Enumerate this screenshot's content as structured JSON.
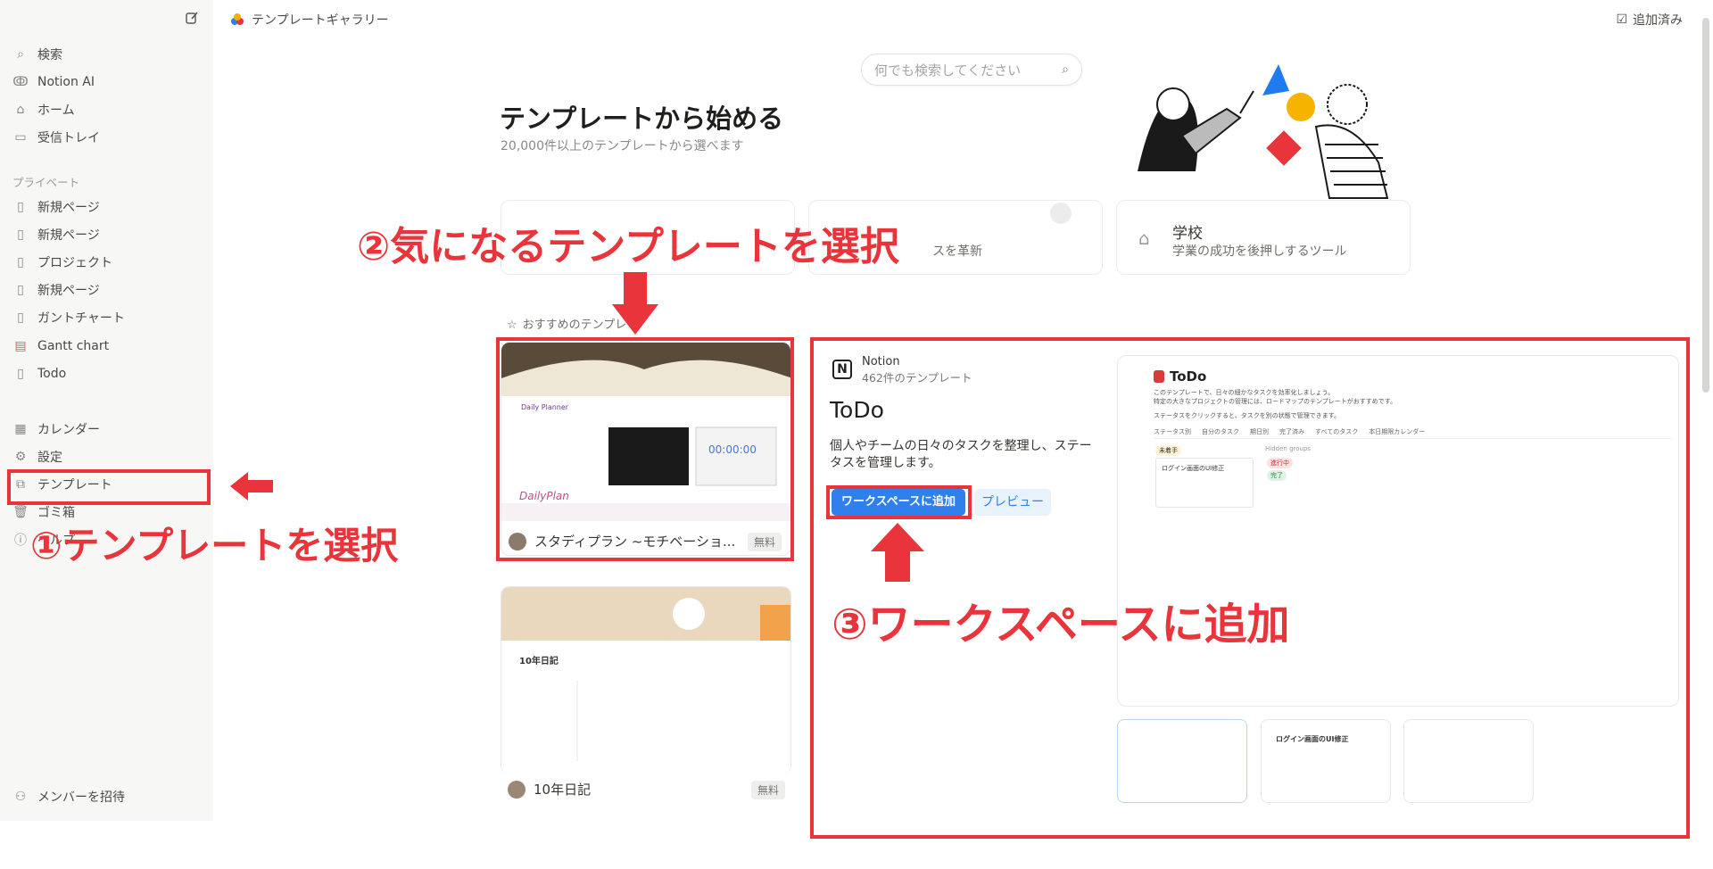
{
  "sidebar": {
    "items": [
      {
        "icon": "search-icon",
        "label": "検索"
      },
      {
        "icon": "notion-ai-icon",
        "label": "Notion AI"
      },
      {
        "icon": "home-icon",
        "label": "ホーム"
      },
      {
        "icon": "inbox-icon",
        "label": "受信トレイ"
      }
    ],
    "private_label": "プライベート",
    "pages": [
      {
        "icon": "page-icon",
        "label": "新規ページ"
      },
      {
        "icon": "page-icon",
        "label": "新規ページ"
      },
      {
        "icon": "page-icon",
        "label": "プロジェクト"
      },
      {
        "icon": "page-icon",
        "label": "新規ページ"
      },
      {
        "icon": "page-icon",
        "label": "ガントチャート"
      },
      {
        "icon": "calendar-page-icon",
        "label": "Gantt chart"
      },
      {
        "icon": "page-icon",
        "label": "Todo"
      }
    ],
    "bottom": [
      {
        "icon": "calendar-icon",
        "label": "カレンダー"
      },
      {
        "icon": "gear-icon",
        "label": "設定"
      },
      {
        "icon": "template-icon",
        "label": "テンプレート"
      },
      {
        "icon": "trash-icon",
        "label": "ゴミ箱"
      },
      {
        "icon": "help-icon",
        "label": "ヘルプ"
      }
    ],
    "invite": "メンバーを招待"
  },
  "header": {
    "breadcrumb": "テンプレートギャラリー",
    "added": "追加済み"
  },
  "search": {
    "placeholder": "何でも検索してください"
  },
  "hero": {
    "title": "テンプレートから始める",
    "subtitle": "20,000件以上のテンプレートから選べます"
  },
  "categories": [
    {
      "title": "",
      "desc": "スを革新"
    },
    {
      "title": "学校",
      "desc": "学業の成功を後押しするツール"
    }
  ],
  "recommended_label": "おすすめのテンプレ",
  "template_cards": [
    {
      "name": "スタディプラン ~モチベーショ...",
      "badge": "無料"
    },
    {
      "name": "10年日記",
      "badge": "無料"
    }
  ],
  "card_thumb_texts": {
    "daily_planner": "Daily Planner",
    "daily_plan": "DailyPlan",
    "timer": "00:00:00",
    "diary_title": "10年日記"
  },
  "preview": {
    "author": "Notion",
    "count": "462件のテンプレート",
    "title": "ToDo",
    "description": "個人やチームの日々のタスクを整理し、ステータスを管理します。",
    "add_button": "ワークスペースに追加",
    "preview_button": "プレビュー",
    "inner_title": "ToDo",
    "inner_line1": "このテンプレートで、日々の細かなタスクを効率化しましょう。",
    "inner_line2": "特定の大きなプロジェクトの管理には、ロードマップのテンプレートがおすすめです。",
    "inner_line3": "ステータスをクリックすると、タスクを別の状態で管理できます。",
    "inner_tabs": [
      "ステータス別",
      "自分のタスク",
      "期日別",
      "完了済み",
      "すべてのタスク",
      "本日期限カレンダー"
    ],
    "group_label": "Hidden groups",
    "statuses": [
      "未着手",
      "進行中",
      "完了"
    ],
    "task": "ログイン画面のUI修正",
    "small_thumb_title": "ログイン画面のUI修正"
  },
  "annotations": {
    "step1": "①テンプレートを選択",
    "step2": "②気になるテンプレートを選択",
    "step3": "③ワークスペースに追加"
  }
}
